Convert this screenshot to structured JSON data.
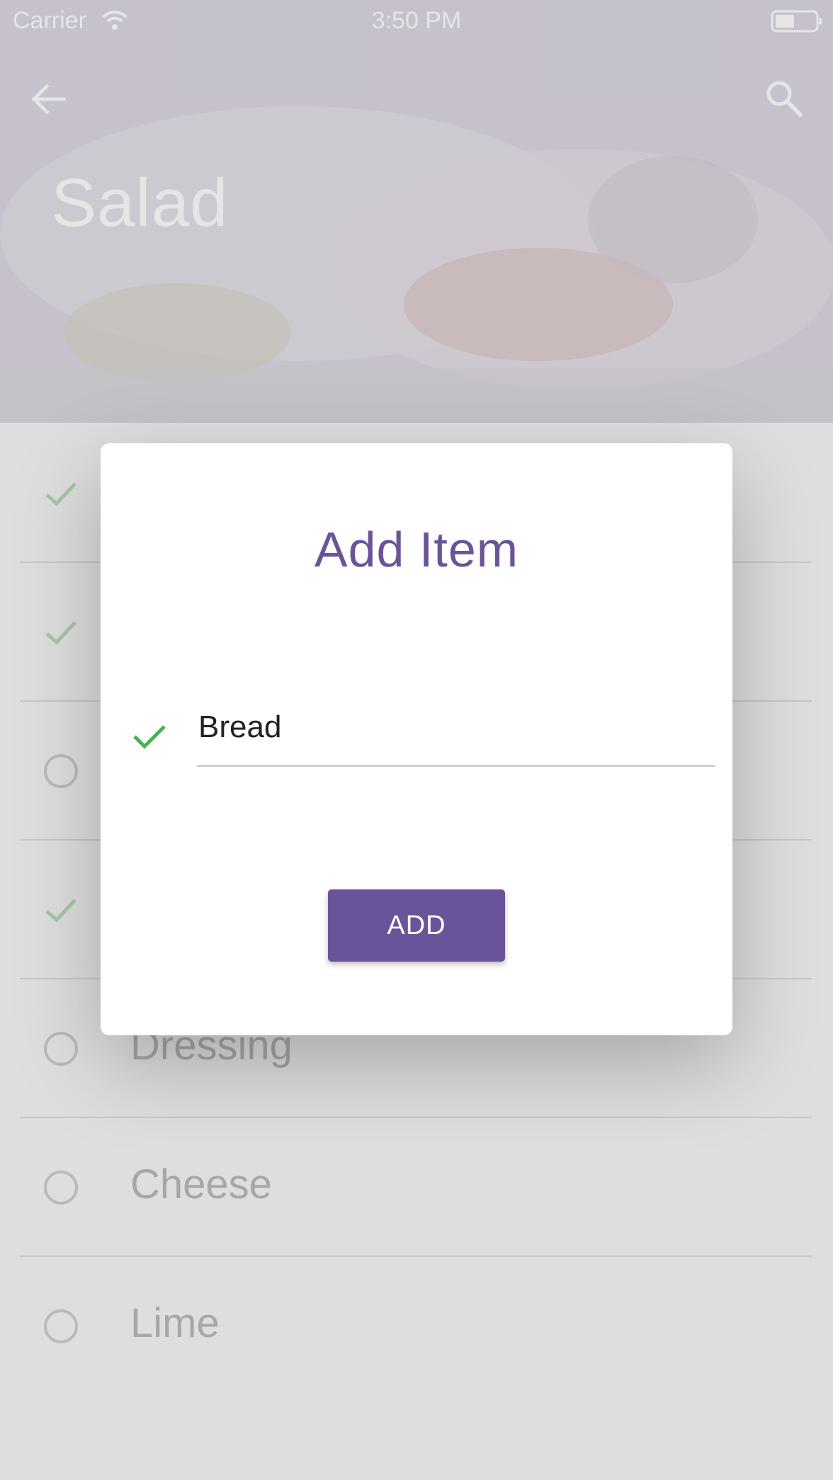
{
  "status_bar": {
    "carrier": "Carrier",
    "time": "3:50 PM"
  },
  "header": {
    "title": "Salad",
    "back_icon": "arrow-left-icon",
    "search_icon": "search-icon"
  },
  "list": {
    "items": [
      {
        "label": "",
        "checked": true
      },
      {
        "label": "",
        "checked": true
      },
      {
        "label": "",
        "checked": false
      },
      {
        "label": "",
        "checked": true
      },
      {
        "label": "Dressing",
        "checked": false
      },
      {
        "label": "Cheese",
        "checked": false
      },
      {
        "label": "Lime",
        "checked": false
      }
    ]
  },
  "dialog": {
    "title": "Add Item",
    "input_value": "Bread",
    "button_label": "ADD"
  },
  "colors": {
    "accent": "#6a5499",
    "check_green": "#4caf50",
    "check_faded": "#b8dcba"
  }
}
